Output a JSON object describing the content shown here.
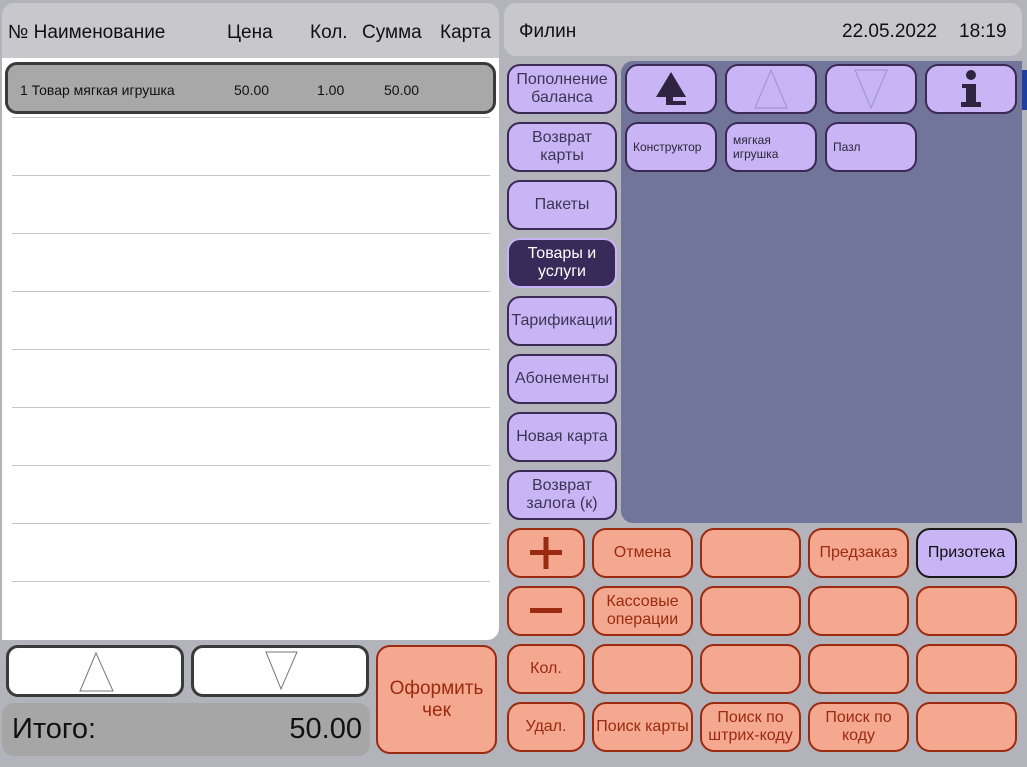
{
  "order_table": {
    "headers": {
      "num_name": "№ Наименование",
      "price": "Цена",
      "qty": "Кол.",
      "sum": "Сумма",
      "card": "Карта"
    },
    "rows": [
      {
        "num_name": "1 Товар мягкая игрушка",
        "price": "50.00",
        "qty": "1.00",
        "sum": "50.00"
      }
    ]
  },
  "total": {
    "label": "Итого:",
    "value": "50.00"
  },
  "checkout_label": "Оформить чек",
  "top_bar": {
    "operator": "Филин",
    "date": "22.05.2022",
    "time": "18:19"
  },
  "categories": [
    {
      "label": "Пополнение баланса",
      "active": false
    },
    {
      "label": "Возврат карты",
      "active": false
    },
    {
      "label": "Пакеты",
      "active": false
    },
    {
      "label": "Товары и услуги",
      "active": true
    },
    {
      "label": "Тарификации",
      "active": false
    },
    {
      "label": "Абонементы",
      "active": false
    },
    {
      "label": "Новая карта",
      "active": false
    },
    {
      "label": "Возврат залога (к)",
      "active": false
    }
  ],
  "toolbar_icons": [
    "tree-up-icon",
    "arrow-up-icon",
    "arrow-down-icon",
    "info-icon"
  ],
  "goods": [
    "Конструктор",
    "мягкая игрушка",
    "Пазл"
  ],
  "keypad": {
    "plus_icon": "plus-icon",
    "minus_icon": "minus-icon",
    "cancel": "Отмена",
    "preorder": "Предзаказ",
    "prize_store": "Призотека",
    "cash_ops": "Кассовые операции",
    "qty": "Кол.",
    "delete": "Удал.",
    "search_card": "Поиск карты",
    "search_barcode": "Поиск по штрих-коду",
    "search_code": "Поиск по коду"
  },
  "colors": {
    "accent_lilac": "#c9b5f5",
    "active_category": "#3a2a5a",
    "goods_panel": "#72759a",
    "keypad_salmon": "#f4a890",
    "keypad_text": "#9a2a10"
  }
}
